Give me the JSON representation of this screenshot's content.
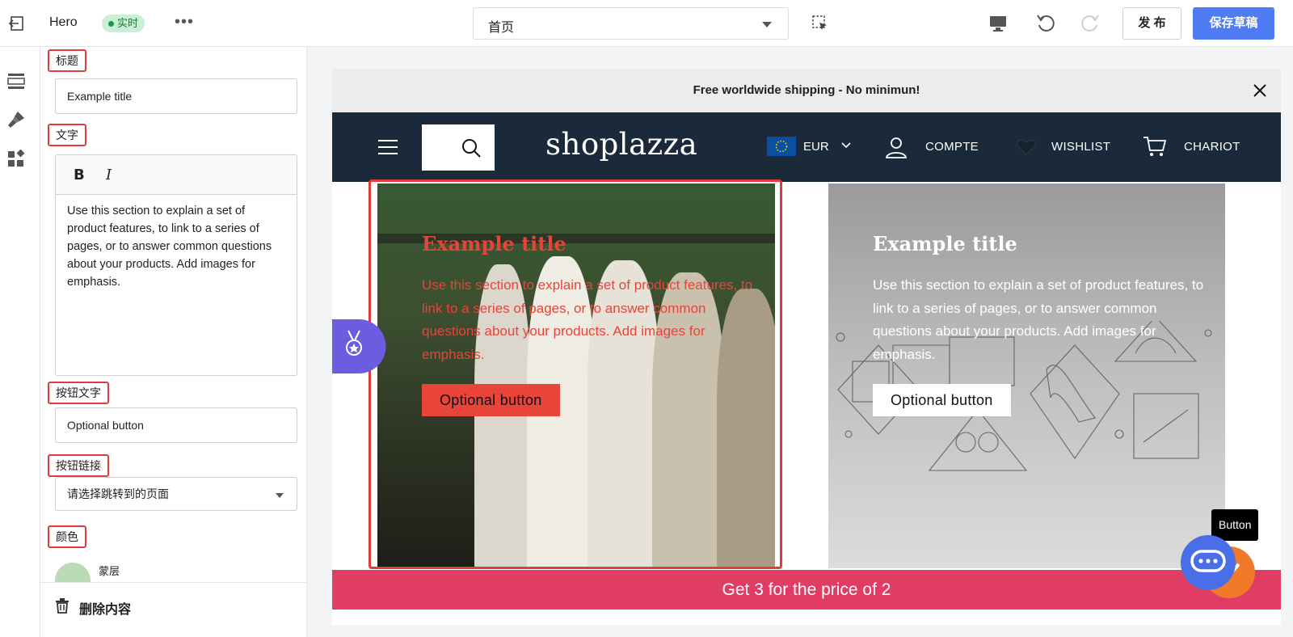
{
  "topbar": {
    "section_name": "Hero",
    "live_badge": "实时",
    "more": "•••",
    "page_select": "首页",
    "publish_label": "发 布",
    "save_draft_label": "保存草稿"
  },
  "panel": {
    "title_label": "标题",
    "title_value": "Example title",
    "text_label": "文字",
    "text_bold": "B",
    "text_italic": "I",
    "text_value": "Use this section to explain a set of product features, to link to a series of pages, or to answer common questions about your products. Add images for emphasis.",
    "button_text_label": "按钮文字",
    "button_text_value": "Optional button",
    "button_link_label": "按钮链接",
    "button_link_placeholder": "请选择跳转到的页面",
    "color_label": "颜色",
    "overlay_label": "蒙层",
    "overlay_color": "#b9dbb6",
    "delete_label": "删除内容"
  },
  "preview": {
    "announcement": "Free worldwide shipping - No minimun!",
    "logo": "shoplazza",
    "currency": "EUR",
    "account": "COMPTE",
    "wishlist": "WISHLIST",
    "cart": "CHARIOT",
    "card1": {
      "title": "Example title",
      "text": "Use this section to explain a set of product features, to link to a series of pages, or to answer common questions about your products. Add images for emphasis.",
      "button": "Optional button",
      "accent_color": "#e8443a"
    },
    "card2": {
      "title": "Example title",
      "text": "Use this section to explain a set of product features, to link to a series of pages, or to answer common questions about your products. Add images for emphasis.",
      "button": "Optional button"
    },
    "promo_bar": "Get 3 for the price of 2",
    "tooltip": "Button"
  },
  "colors": {
    "primary": "#4f7cf3",
    "highlight": "#e23b3b",
    "nav_bg": "#1a2a3a",
    "promo_bg": "#e03d65"
  },
  "icons": [
    "exit-icon",
    "select-element-icon",
    "desktop-icon",
    "undo-icon",
    "redo-icon",
    "sections-icon",
    "theme-brush-icon",
    "apps-icon",
    "trash-icon",
    "close-icon",
    "hamburger-icon",
    "search-icon",
    "eu-flag-icon",
    "chevron-down-icon",
    "user-icon",
    "heart-icon",
    "cart-icon",
    "medal-icon",
    "chat-icon"
  ]
}
